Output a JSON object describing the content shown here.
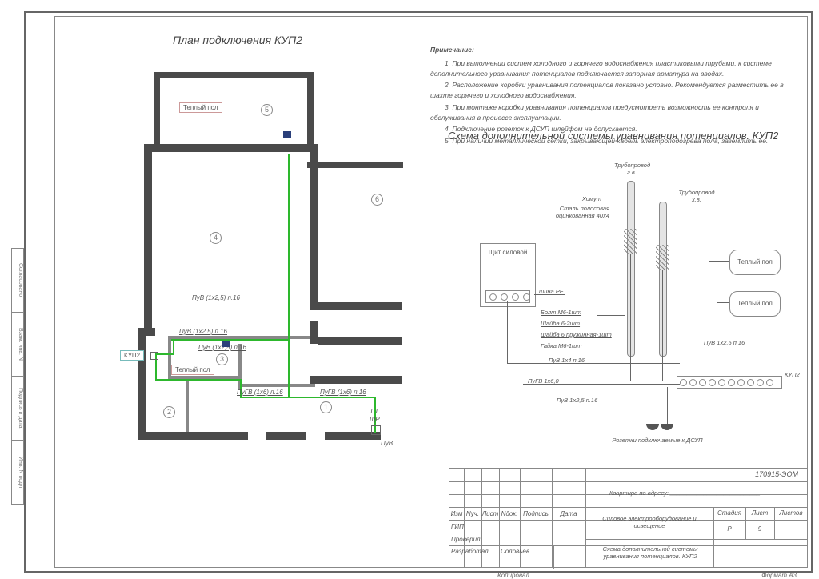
{
  "side_labels": [
    "Согласовано",
    "Взам. инв. N",
    "Подпись и дата",
    "Инв. N подл"
  ],
  "plan": {
    "title": "План подключения КУП2",
    "rooms": [
      "1",
      "2",
      "3",
      "4",
      "5",
      "6"
    ],
    "tags": {
      "tp": "Теплый пол",
      "kup": "КУП2",
      "schr": "ЩР",
      "tt": "Т.Т."
    },
    "wires": {
      "w1": "ПуВ (1х2,5) п.16",
      "w2": "ПуВ (1х2,5) п.16",
      "w3": "ПуВ (1х2,5) п.16",
      "w4": "ПуГВ (1х6) п.16",
      "w5": "ПуГВ (1х6) п.16",
      "w6": "ПуВ"
    }
  },
  "notes": {
    "hd": "Примечание:",
    "n1": "1. При выполнении систем холодного и горячего водоснабжения пластиковыми трубами, к системе дополнительного уравнивания потенциалов подключается запорная арматура на вводах.",
    "n2": "2. Расположение коробки уравнивания потенциалов показано условно. Рекомендуется разместить ее в шахте горячего и холодного водоснабжения.",
    "n3": "3. При монтаже коробки уравнивания потенциалов предусмотреть возможность ее контроля и обслуживания в процессе эксплуатации.",
    "n4": "4. Подключение розеток к ДСУП шлейфом не допускается.",
    "n5": "5. При наличии металлической сетки, закрывающей кабель электроподогрева пола, заземлить ее."
  },
  "schem": {
    "title": "Схема дополнительной системы уравнивания потенциалов. КУП2",
    "pipe_hot": "Трубопровод г.в.",
    "pipe_cold": "Трубопровод х.в.",
    "clamp_top": "Хомут",
    "clamp_mid": "Сталь полосовая оцинкованная 40х4",
    "panel": "Щит силовой",
    "pe": "шина PE",
    "bolt": "Болт М6-1шт",
    "washer": "Шайба 6-2шт",
    "spring": "Шайба 6 пружинная-1шт",
    "nut": "Гайка М6-1шт",
    "tp": "Теплый пол",
    "w_tp": "ПуВ 1х2,5 п.16",
    "w_panel": "ПуВ 1х4 п.16",
    "w_bus": "ПуГВ 1х6,0",
    "w_sock": "ПуВ 1х2,5 п.16",
    "kup": "КУП2",
    "sockets": "Розетки подключаемые к ДСУП"
  },
  "tb": {
    "proj": "170915-ЭОМ",
    "addr_lbl": "Квартира по адресу:",
    "cols": [
      "Изм",
      "Nуч.",
      "Лист",
      "Nдок.",
      "Подпись",
      "Дата"
    ],
    "gip": "ГИП",
    "checked": "Проверил",
    "dev": "Разработал",
    "dev_name": "Соловьев",
    "desc1": "Силовое электрооборудование и освещение",
    "desc2": "Схема дополнительной системы уравнивания потенциалов. КУП2",
    "stage_lbl": "Стадия",
    "sheet_lbl": "Лист",
    "sheets_lbl": "Листов",
    "stage": "Р",
    "sheet": "9",
    "sheets": "",
    "copy": "Копировал",
    "format": "Формат А3"
  }
}
